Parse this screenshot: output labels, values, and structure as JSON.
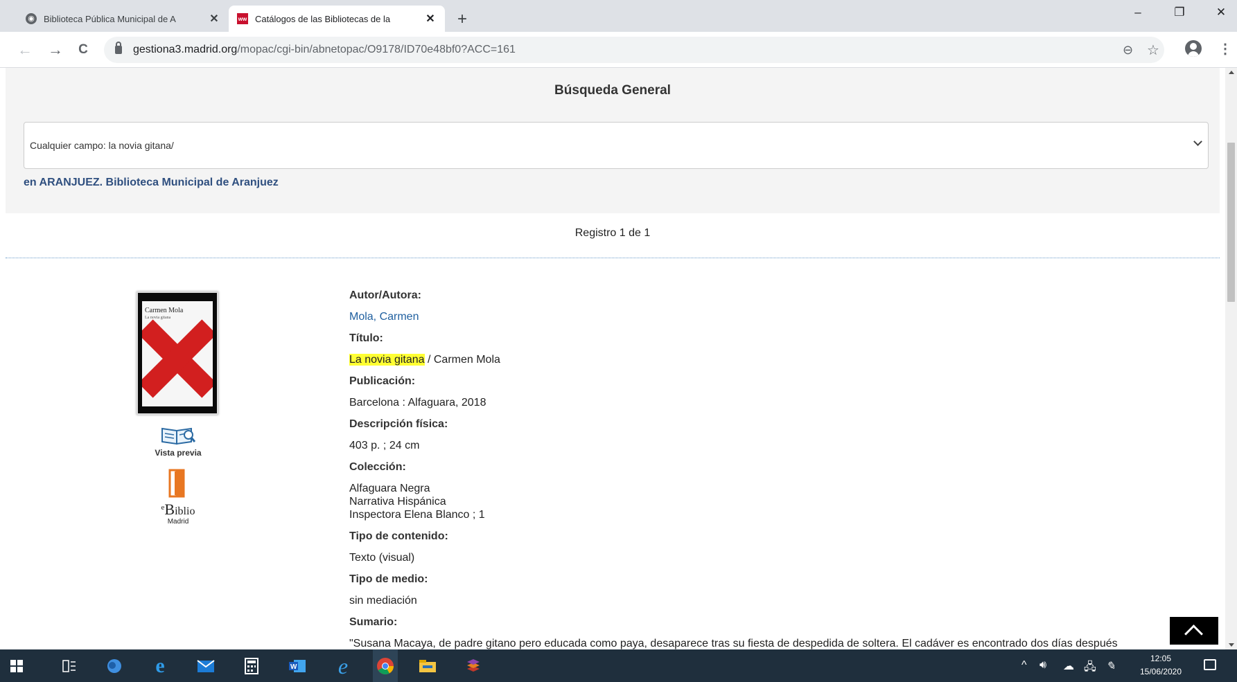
{
  "browser": {
    "tabs": [
      {
        "title": "Biblioteca Pública Municipal de A",
        "active": false,
        "favicon": "globe-icon"
      },
      {
        "title": "Catálogos de las Bibliotecas de la",
        "active": true,
        "favicon": "madrid-logo-icon"
      }
    ],
    "new_tab": "+",
    "controls": {
      "minimize": "–",
      "restore": "❐",
      "close": "✕"
    },
    "nav": {
      "back": "←",
      "forward": "→",
      "reload": "C"
    },
    "url": {
      "host": "gestiona3.madrid.org",
      "path": "/mopac/cgi-bin/abnetopac/O9178/ID70e48bf0?ACC=161"
    },
    "omnibox_icons": {
      "zoom": "⊖",
      "star": "☆"
    },
    "menu": "⋮"
  },
  "search": {
    "heading": "Búsqueda General",
    "selected_value": "Cualquier campo: la novia gitana/",
    "library": "en ARANJUEZ. Biblioteca Municipal de Aranjuez"
  },
  "results": {
    "count": "Registro 1 de 1"
  },
  "cover": {
    "author": "Carmen Mola",
    "title": "La novia gitana"
  },
  "side_links": {
    "preview": "Vista previa",
    "eblio_e": "e",
    "eblio_b": "B",
    "eblio_rest": "iblio",
    "eblio_sub": "Madrid"
  },
  "record": {
    "author_label": "Autor/Autora:",
    "author_value": "Mola, Carmen",
    "title_label": "Título:",
    "title_highlight": "La novia gitana",
    "title_rest": " / Carmen Mola",
    "publication_label": "Publicación:",
    "publication_value": "Barcelona : Alfaguara, 2018",
    "physical_label": "Descripción física:",
    "physical_value": "403 p. ; 24 cm",
    "collection_label": "Colección:",
    "collection_values": [
      "Alfaguara Negra",
      "Narrativa Hispánica",
      "Inspectora Elena Blanco ; 1"
    ],
    "content_type_label": "Tipo de contenido:",
    "content_type_value": "Texto (visual)",
    "media_type_label": "Tipo de medio:",
    "media_type_value": "sin mediación",
    "summary_label": "Sumario:",
    "summary_value": "\"Susana Macaya, de padre gitano pero educada como paya, desaparece tras su fiesta de despedida de soltera. El cadáver es encontrado dos días después"
  },
  "taskbar": {
    "clock_time": "12:05",
    "clock_date": "15/06/2020",
    "tray_chevron": "^"
  }
}
